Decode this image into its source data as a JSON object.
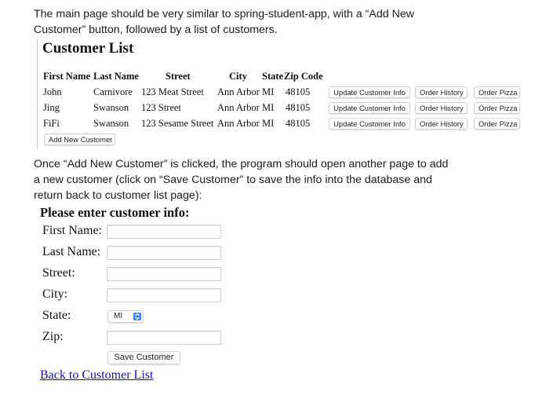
{
  "instructions": {
    "para1_line1": "The main page should be very similar to spring-student-app, with a “Add New",
    "para1_line2": "Customer” button, followed by a list of customers.",
    "para2_line1": "Once “Add New Customer” is clicked, the program should open another page to add",
    "para2_line2": "a new customer (click on “Save Customer” to save the info into the database and",
    "para2_line3": "return back to customer list page):"
  },
  "customer_list": {
    "title": "Customer List",
    "headers": {
      "first_name": "First Name",
      "last_name": "Last Name",
      "street": "Street",
      "city": "City",
      "state": "State",
      "zip": "Zip Code"
    },
    "rows": [
      {
        "first": "John",
        "last": "Carnivore",
        "street": "123 Meat Street",
        "city": "Ann Arbor",
        "state": "MI",
        "zip": "48105"
      },
      {
        "first": "Jing",
        "last": "Swanson",
        "street": "123 Street",
        "city": "Ann Arbor",
        "state": "MI",
        "zip": "48105"
      },
      {
        "first": "FiFi",
        "last": "Swanson",
        "street": "123 Sesame Street",
        "city": "Ann Arbor",
        "state": "MI",
        "zip": "48105"
      }
    ],
    "row_buttons": {
      "update": "Update Customer Info",
      "history": "Order History",
      "pizza": "Order Pizza"
    },
    "add_button": "Add New Customer"
  },
  "form": {
    "title": "Please enter customer info:",
    "labels": {
      "first_name": "First Name:",
      "last_name": "Last Name:",
      "street": "Street:",
      "city": "City:",
      "state": "State:",
      "zip": "Zip:"
    },
    "state_value": "MI",
    "save_button": "Save Customer",
    "back_link": "Back to Customer List"
  }
}
